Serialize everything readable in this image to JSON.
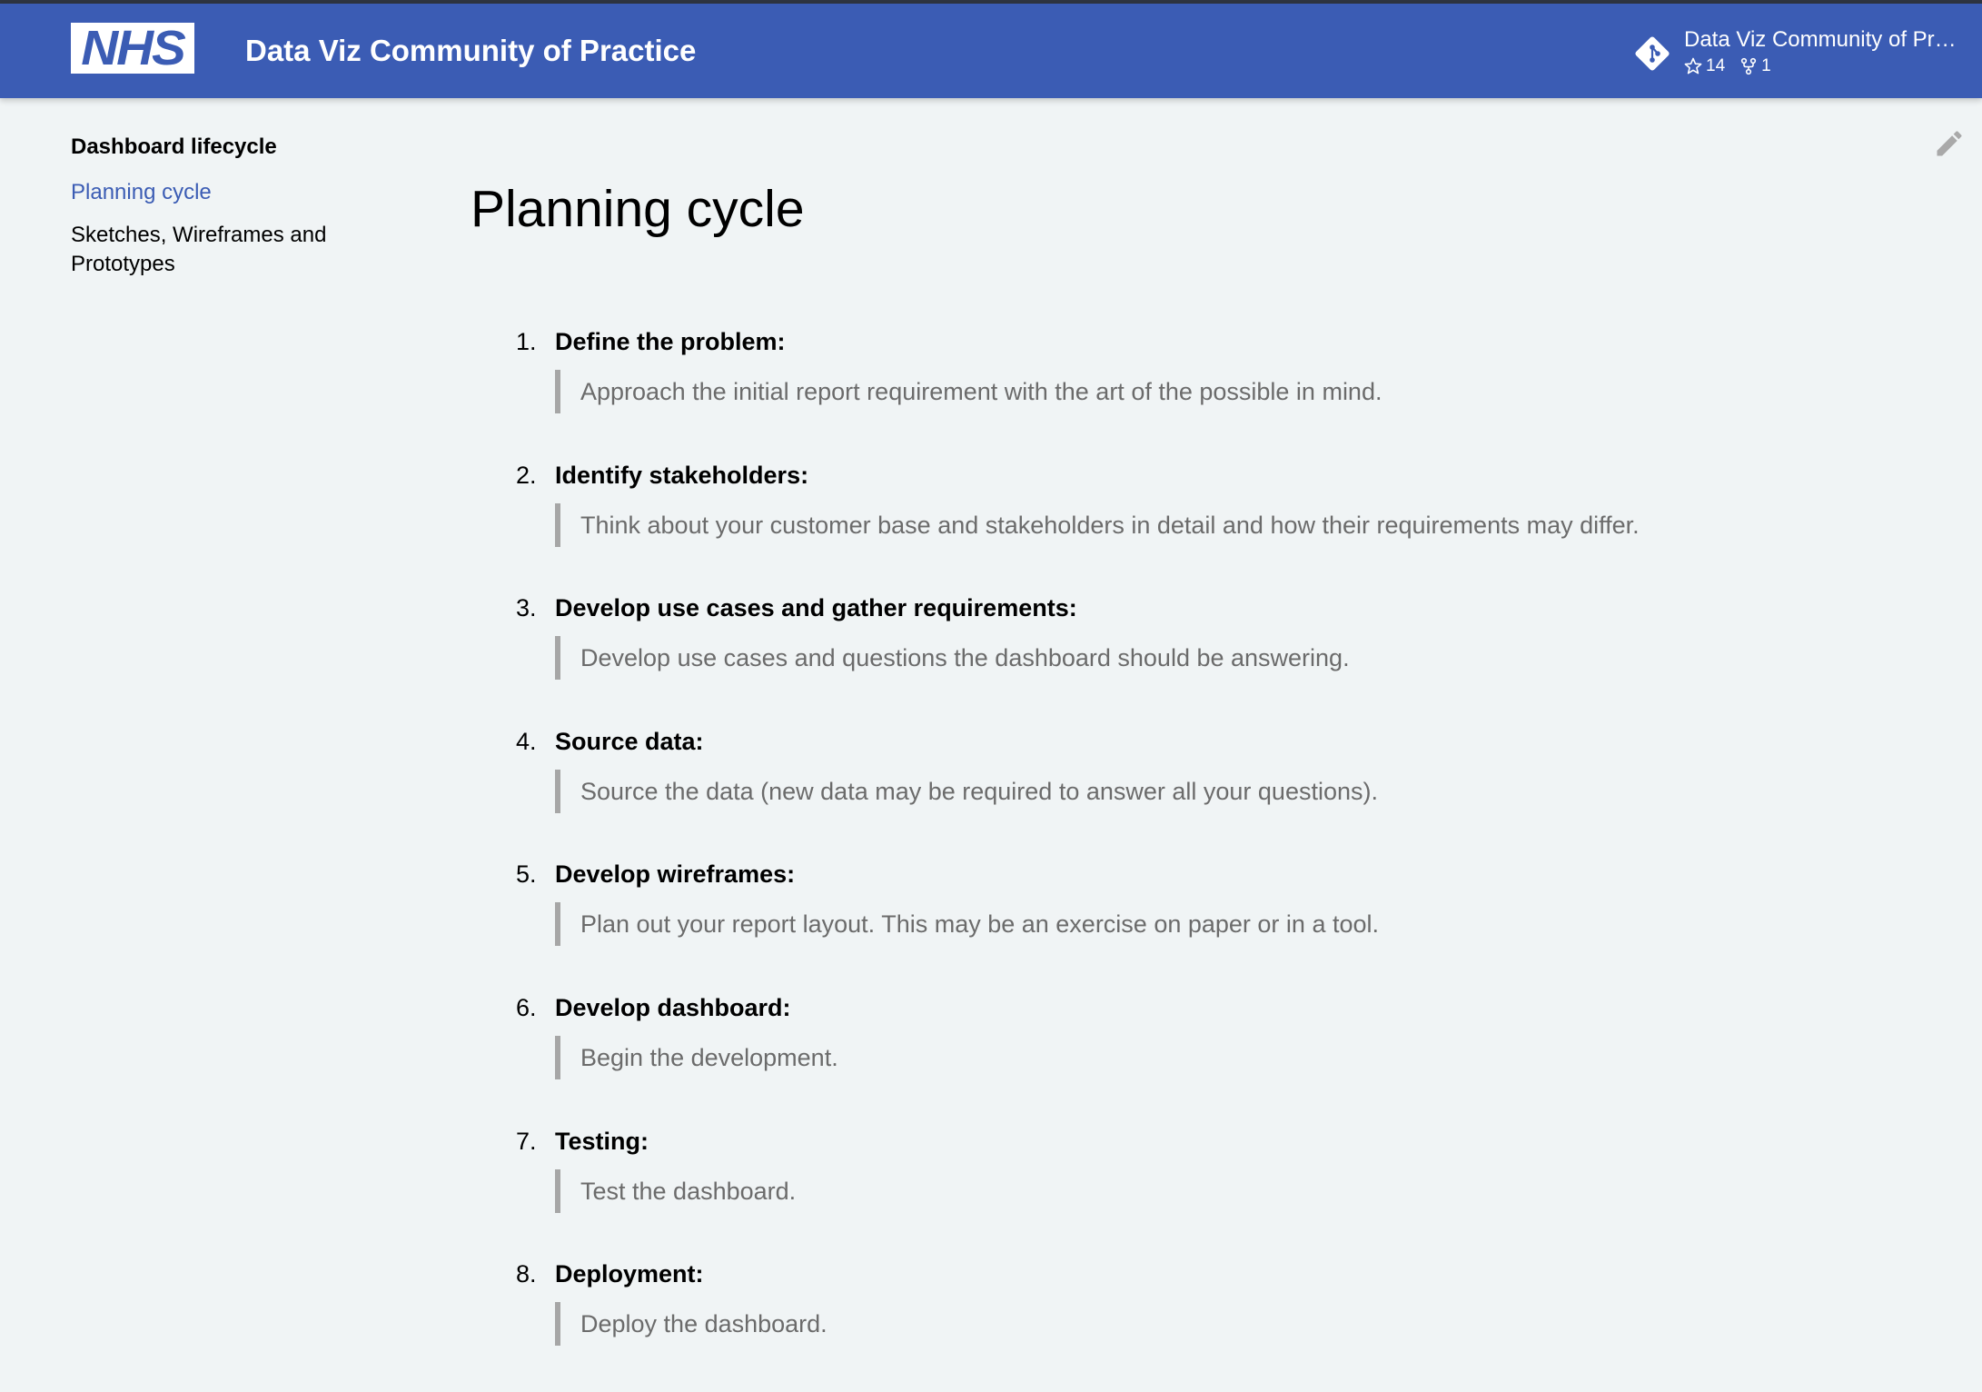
{
  "header": {
    "logo_text": "NHS",
    "site_title": "Data Viz Community of Practice",
    "repo": {
      "name": "Data Viz Community of Pra…",
      "stars": "14",
      "forks": "1",
      "icon": "git-icon"
    }
  },
  "sidebar": {
    "heading": "Dashboard lifecycle",
    "items": [
      {
        "label": "Planning cycle",
        "active": true
      },
      {
        "label": "Sketches, Wireframes and Prototypes",
        "active": false
      }
    ]
  },
  "main": {
    "title": "Planning cycle",
    "edit_icon": "pencil-icon",
    "steps": [
      {
        "number": "1.",
        "title": "Define the problem:",
        "text": "Approach the initial report requirement with the art of the possible in mind."
      },
      {
        "number": "2.",
        "title": "Identify stakeholders:",
        "text": "Think about your customer base and stakeholders in detail and how their requirements may differ."
      },
      {
        "number": "3.",
        "title": "Develop use cases and gather requirements:",
        "text": "Develop use cases and questions the dashboard should be answering."
      },
      {
        "number": "4.",
        "title": "Source data:",
        "text": "Source the data (new data may be required to answer all your questions)."
      },
      {
        "number": "5.",
        "title": "Develop wireframes:",
        "text": "Plan out your report layout. This may be an exercise on paper or in a tool."
      },
      {
        "number": "6.",
        "title": "Develop dashboard:",
        "text": "Begin the development."
      },
      {
        "number": "7.",
        "title": "Testing:",
        "text": "Test the dashboard."
      },
      {
        "number": "8.",
        "title": "Deployment:",
        "text": "Deploy the dashboard."
      }
    ]
  },
  "colors": {
    "header_bg": "#3b5cb4",
    "page_bg": "#f0f4f5",
    "active_link": "#3b5cb4",
    "quote_text": "#6b6b6b",
    "quote_border": "#a6a6a6"
  }
}
